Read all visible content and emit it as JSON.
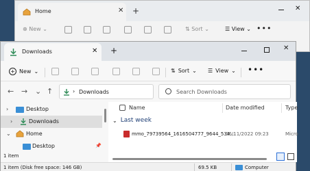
{
  "back_window": {
    "tab_title": "Home",
    "tab_close": "✕",
    "tab_add": "+",
    "close": "✕",
    "toolbar": {
      "new_label": "New",
      "sort_label": "Sort",
      "view_label": "View",
      "more": "•••"
    }
  },
  "window": {
    "tab_title": "Downloads",
    "tab_close": "✕",
    "tab_add": "+",
    "controls": {
      "close": "✕"
    },
    "toolbar": {
      "new_label": "New",
      "sort_label": "Sort",
      "view_label": "View",
      "more": "•••",
      "chev": "⌄"
    },
    "nav": {
      "back": "←",
      "forward": "→",
      "down": "⌄",
      "up": "↑"
    },
    "address": {
      "path": "Downloads",
      "chevron": "›"
    },
    "search": {
      "placeholder": "Search Downloads"
    },
    "nav_pane": {
      "items": [
        {
          "label": "Desktop",
          "chevron": "›"
        },
        {
          "label": "Downloads",
          "chevron": "›"
        },
        {
          "label": "Home",
          "chevron": "⌄"
        },
        {
          "label": "Desktop",
          "chevron": ""
        }
      ]
    },
    "columns": {
      "name": "Name",
      "date": "Date modified",
      "type": "Type"
    },
    "group": {
      "label": "Last week",
      "chevron": "⌄"
    },
    "files": [
      {
        "name": "mmo_79739564_1616504777_9644_534...",
        "date": "06/11/2022 09:23",
        "type": "Micro"
      }
    ],
    "status": {
      "count": "1 item",
      "selection": "1 item (Disk free space: 146 GB)",
      "size": "69.5 KB",
      "location": "Computer"
    }
  },
  "colors": {
    "accent": "#2b6fd6",
    "folder_green": "#2e8b57",
    "desktop_blue": "#3a8fd6",
    "home_orange": "#e8a33d",
    "pdf_red": "#c92c2c"
  }
}
